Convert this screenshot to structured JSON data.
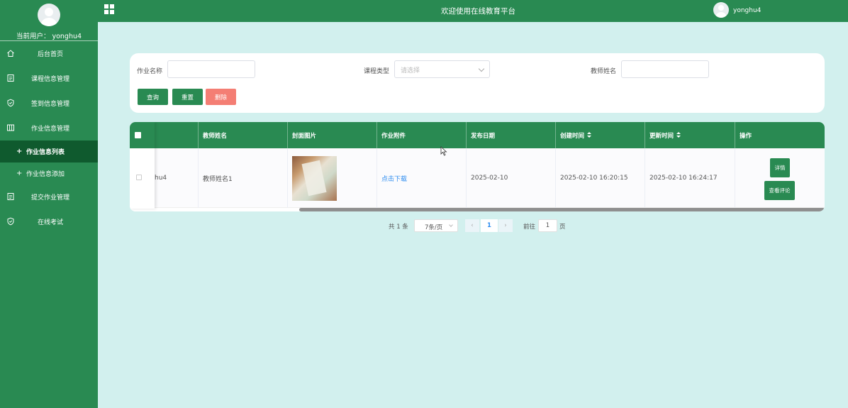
{
  "sidebar": {
    "current_user": "当前用户： yonghu4",
    "items": [
      {
        "label": "后台首页",
        "icon": "home-icon"
      },
      {
        "label": "课程信息管理",
        "icon": "document-icon"
      },
      {
        "label": "签到信息管理",
        "icon": "shield-icon"
      },
      {
        "label": "作业信息管理",
        "icon": "columns-icon"
      }
    ],
    "subitems": [
      {
        "label": "作业信息列表",
        "active": true
      },
      {
        "label": "作业信息添加",
        "active": false
      }
    ],
    "items_after": [
      {
        "label": "提交作业管理",
        "icon": "document-icon"
      },
      {
        "label": "在线考试",
        "icon": "shield-icon"
      }
    ]
  },
  "topbar": {
    "title": "欢迎使用在线教育平台",
    "username": "yonghu4"
  },
  "search": {
    "homework_name_label": "作业名称",
    "course_type_label": "课程类型",
    "course_type_placeholder": "请选择",
    "teacher_name_label": "教师姓名",
    "query_button": "查询",
    "reset_button": "重置",
    "delete_button": "删除"
  },
  "table": {
    "headers": [
      "教师姓名",
      "封面图片",
      "作业附件",
      "发布日期",
      "创建时间",
      "更新时间",
      "操作"
    ],
    "rows": [
      {
        "partial_user": "hu4",
        "teacher_name": "教师姓名1",
        "attachment_link": "点击下载",
        "publish_date": "2025-02-10",
        "created_at": "2025-02-10 16:20:15",
        "updated_at": "2025-02-10 16:24:17",
        "detail_button": "详情",
        "comments_button": "查看评论"
      }
    ]
  },
  "pagination": {
    "total": "共 1 条",
    "page_size": "7条/页",
    "current_page": "1",
    "goto_label": "前往",
    "goto_value": "1",
    "page_suffix": "页"
  },
  "colors": {
    "primary": "#298a52",
    "active_sub": "#0f5a2e",
    "background": "#d2f0ee",
    "delete": "#f47e74",
    "link": "#2d8cf0"
  }
}
